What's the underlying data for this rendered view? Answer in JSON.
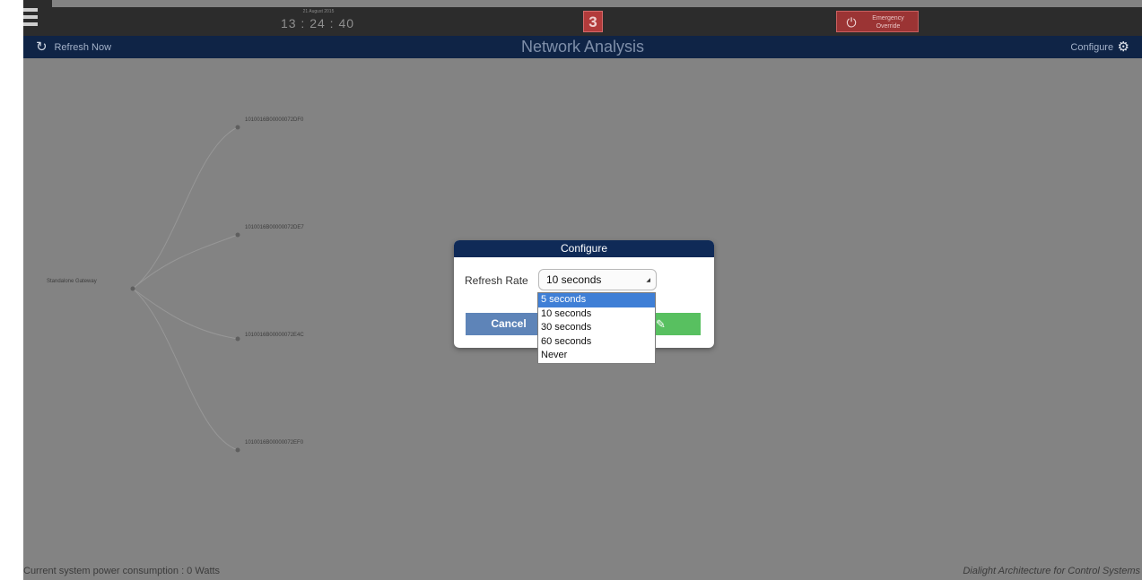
{
  "topbar": {
    "clock_date": "21 August 2015",
    "clock_time": "13 : 24 : 40",
    "alert_count": "3",
    "emergency_label": "Emergency Override"
  },
  "titlebar": {
    "refresh_label": "Refresh Now",
    "title": "Network Analysis",
    "configure_label": "Configure"
  },
  "graph": {
    "root_label": "Standalone Gateway",
    "nodes": [
      {
        "label": "1010016B00000072DF0"
      },
      {
        "label": "1010016B00000072DE7"
      },
      {
        "label": "1010016B00000072E4C"
      },
      {
        "label": "1010016B00000072EF0"
      }
    ]
  },
  "footer": {
    "power_text": "Current system power consumption : 0 Watts",
    "brand_text": "Dialight Architecture for Control Systems"
  },
  "dialog": {
    "title": "Configure",
    "refresh_rate_label": "Refresh Rate",
    "refresh_rate_value": "10 seconds",
    "options": [
      "5 seconds",
      "10 seconds",
      "30 seconds",
      "60 seconds",
      "Never"
    ],
    "highlighted_option": "5 seconds",
    "cancel_label": "Cancel",
    "ok_icon": "pencil-icon"
  },
  "icons": {
    "menu": "hamburger-icon",
    "refresh": "refresh-icon",
    "configure": "gear-icon",
    "emergency": "power-icon"
  },
  "colors": {
    "titlebar": "#0f2446",
    "dialog_header": "#0f2a57",
    "cancel": "#5e84b8",
    "ok": "#58c060",
    "alert": "#b23b3b",
    "highlight": "#3f7fd6"
  }
}
